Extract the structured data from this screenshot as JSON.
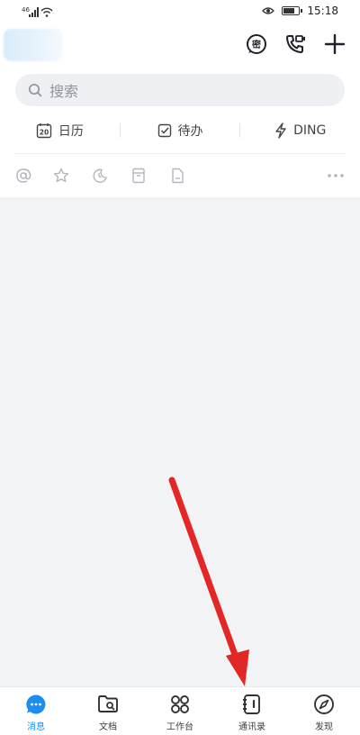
{
  "status_bar": {
    "signal_label": "46",
    "time": "15:18"
  },
  "header": {
    "icons": [
      "encrypted-chat-icon",
      "video-call-icon",
      "add-icon"
    ],
    "encrypted_glyph": "密"
  },
  "search": {
    "placeholder": "搜索"
  },
  "quick_actions": [
    {
      "label": "日历",
      "icon": "calendar-icon",
      "badge": "20"
    },
    {
      "label": "待办",
      "icon": "todo-check-icon"
    },
    {
      "label": "DING",
      "icon": "lightning-icon"
    }
  ],
  "filters": [
    "at-mention-icon",
    "star-icon",
    "later-icon",
    "archive-icon",
    "file-icon",
    "more-icon"
  ],
  "bottom_nav": [
    {
      "label": "消息",
      "icon": "message-icon",
      "active": true
    },
    {
      "label": "文档",
      "icon": "docs-folder-icon",
      "active": false
    },
    {
      "label": "工作台",
      "icon": "workbench-icon",
      "active": false
    },
    {
      "label": "通讯录",
      "icon": "contacts-icon",
      "active": false
    },
    {
      "label": "发现",
      "icon": "discover-icon",
      "active": false
    }
  ],
  "colors": {
    "accent": "#1f8cf0",
    "arrow": "#e32626",
    "background": "#f2f3f5"
  }
}
